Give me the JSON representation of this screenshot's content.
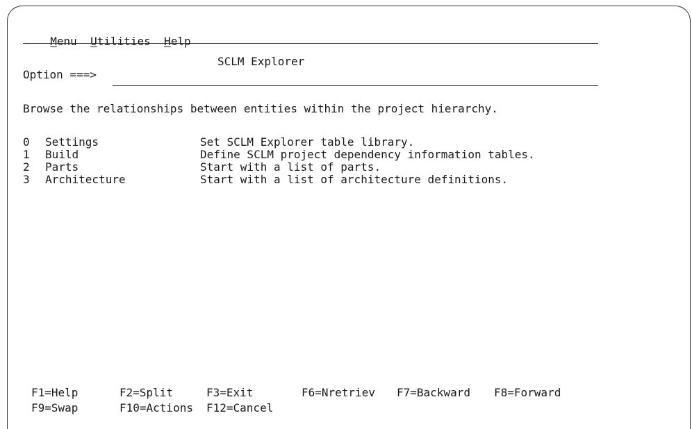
{
  "menu_bar": {
    "items": [
      {
        "hotkey": "M",
        "rest": "enu"
      },
      {
        "hotkey": "U",
        "rest": "tilities"
      },
      {
        "hotkey": "H",
        "rest": "elp"
      }
    ]
  },
  "panel": {
    "title": "SCLM Explorer",
    "option_label": "Option ===>",
    "option_value": "",
    "description": "Browse the relationships between entities within the project hierarchy."
  },
  "options": [
    {
      "number": "0",
      "name": "Settings",
      "description": "Set SCLM Explorer table library."
    },
    {
      "number": "1",
      "name": "Build",
      "description": "Define SCLM project dependency information tables."
    },
    {
      "number": "2",
      "name": "Parts",
      "description": "Start with a list of parts."
    },
    {
      "number": "3",
      "name": "Architecture",
      "description": "Start with a list of architecture definitions."
    }
  ],
  "function_keys": {
    "row1": [
      "F1=Help",
      "F2=Split",
      "F3=Exit",
      "F6=Nretriev",
      "F7=Backward",
      "F8=Forward"
    ],
    "row2": [
      "F9=Swap",
      "F10=Actions",
      "F12=Cancel"
    ]
  }
}
